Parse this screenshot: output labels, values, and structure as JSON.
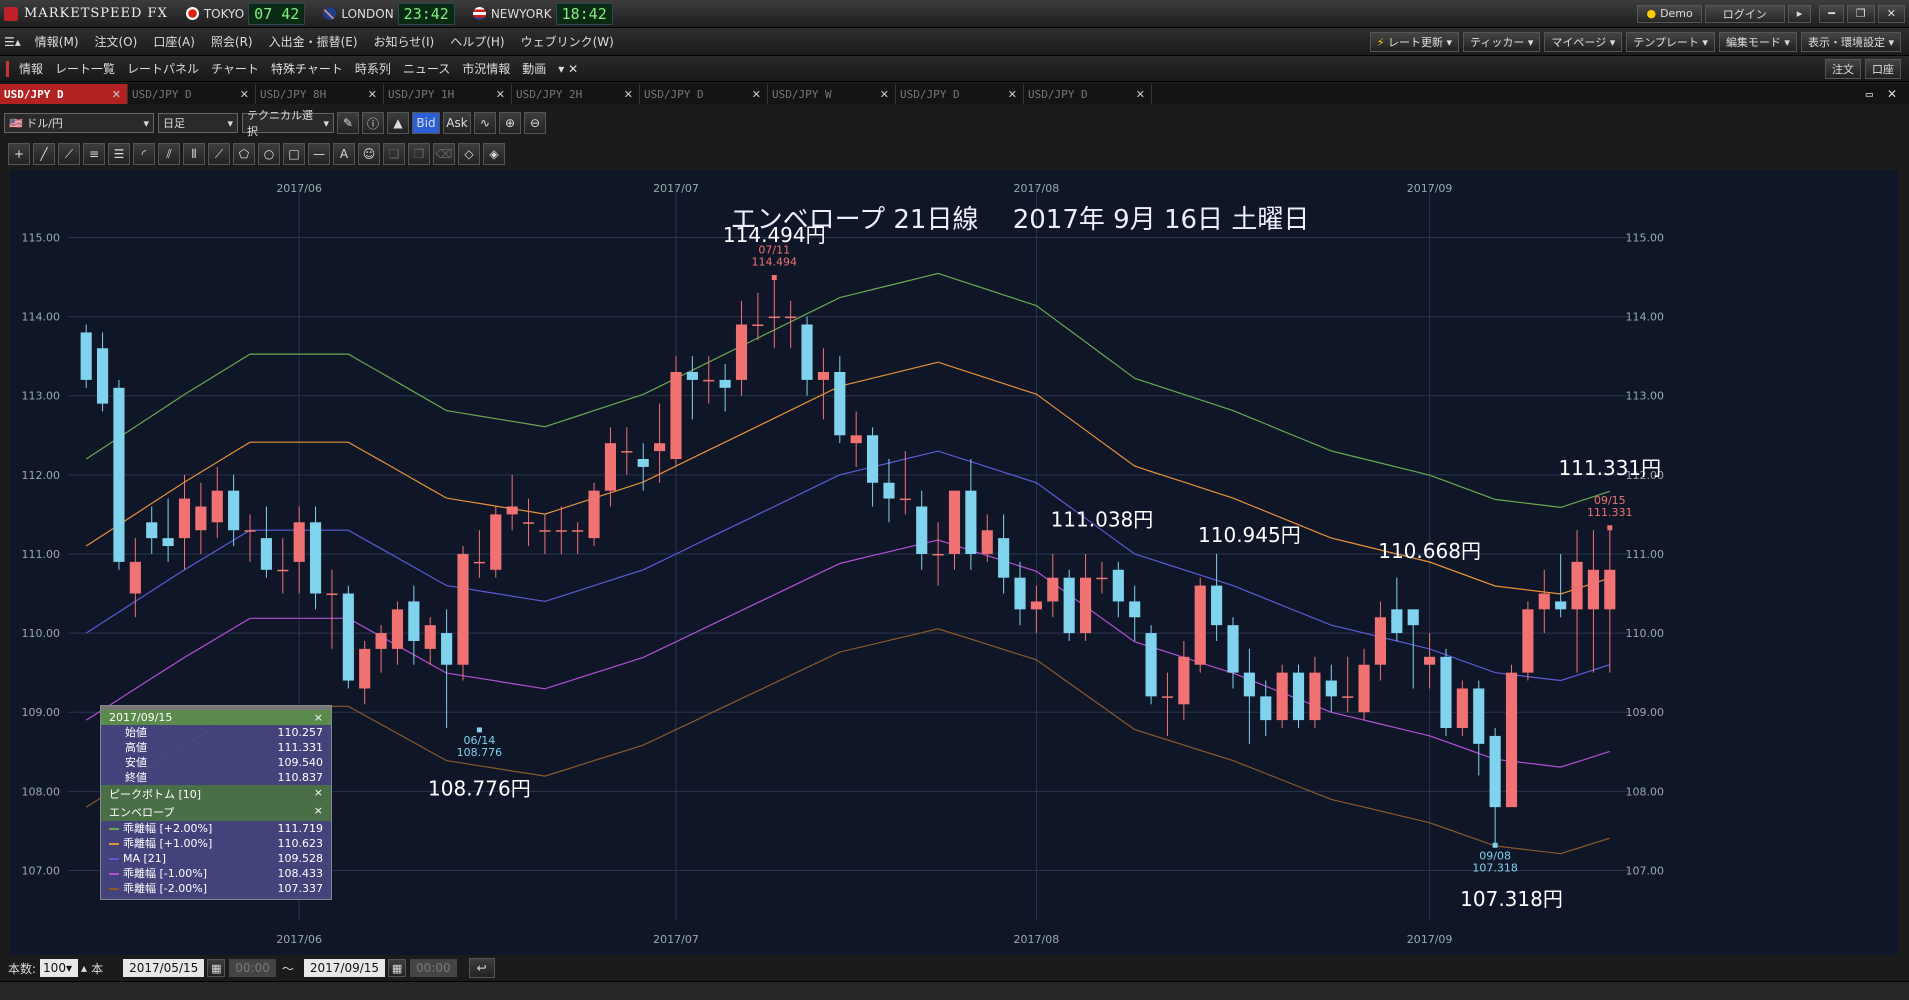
{
  "app": {
    "title": "MARKETSPEED FX"
  },
  "clocks": [
    {
      "city": "TOKYO",
      "time": "07 42"
    },
    {
      "city": "LONDON",
      "time": "23:42"
    },
    {
      "city": "NEWYORK",
      "time": "18:42"
    }
  ],
  "titlebar": {
    "demo": "Demo",
    "login": "ログイン"
  },
  "menu": [
    "情報(M)",
    "注文(O)",
    "口座(A)",
    "照会(R)",
    "入出金・振替(E)",
    "お知らせ(I)",
    "ヘルプ(H)",
    "ウェブリンク(W)"
  ],
  "menu_right": [
    "レート更新",
    "ティッカー",
    "マイページ",
    "テンプレート",
    "編集モード",
    "表示・環境設定"
  ],
  "nav": [
    "情報",
    "レート一覧",
    "レートパネル",
    "チャート",
    "特殊チャート",
    "時系列",
    "ニュース",
    "市況情報",
    "動画"
  ],
  "nav_right": [
    "注文",
    "口座"
  ],
  "tabs": [
    "USD/JPY D",
    "USD/JPY D",
    "USD/JPY 8H",
    "USD/JPY 1H",
    "USD/JPY 2H",
    "USD/JPY D",
    "USD/JPY W",
    "USD/JPY D",
    "USD/JPY D"
  ],
  "toolbar": {
    "pair": "ドル/円",
    "period": "日足",
    "tech": "テクニカル選択",
    "bid": "Bid",
    "ask": "Ask"
  },
  "status": {
    "count_label": "本数:",
    "count": "100",
    "unit": "本",
    "from": "2017/05/15",
    "to": "2017/09/15",
    "tilde": "〜",
    "time1": "00:00",
    "time2": "00:00"
  },
  "info_panel": {
    "date": "2017/09/15",
    "ohlc": [
      {
        "label": "始値",
        "value": "110.257"
      },
      {
        "label": "高値",
        "value": "111.331"
      },
      {
        "label": "安値",
        "value": "109.540"
      },
      {
        "label": "終値",
        "value": "110.837"
      }
    ],
    "peak_label": "ピークボトム [10]",
    "env_label": "エンベロープ",
    "lines": [
      {
        "label": "乖離幅 [+2.00%]",
        "value": "111.719",
        "color": "#6aa84f"
      },
      {
        "label": "乖離幅 [+1.00%]",
        "value": "110.623",
        "color": "#e69138"
      },
      {
        "label": "MA [21]",
        "value": "109.528",
        "color": "#5b5bd6"
      },
      {
        "label": "乖離幅 [-1.00%]",
        "value": "108.433",
        "color": "#b44fd6"
      },
      {
        "label": "乖離幅 [-2.00%]",
        "value": "107.337",
        "color": "#8a5a2a"
      }
    ]
  },
  "chart_data": {
    "type": "candlestick",
    "title": "エンベロープ 21日線　 2017年 9月 16日 土曜日",
    "y_ticks": [
      "115.00",
      "114.00",
      "113.00",
      "112.00",
      "111.00",
      "110.00",
      "109.00",
      "108.00",
      "107.00"
    ],
    "ylim": [
      106.5,
      115.6
    ],
    "x_labels": [
      "2017/06",
      "2017/07",
      "2017/08",
      "2017/09"
    ],
    "x_label_index": [
      13,
      36,
      58,
      82
    ],
    "n": 94,
    "colors": {
      "up": "#f07272",
      "down": "#7fd3ec",
      "bg": "#0f1628",
      "grid": "#2a3550"
    },
    "candles": [
      [
        113.8,
        113.2,
        113.9,
        113.1
      ],
      [
        113.6,
        112.9,
        113.8,
        112.8
      ],
      [
        113.1,
        110.9,
        113.2,
        110.8
      ],
      [
        110.5,
        110.9,
        111.2,
        110.2
      ],
      [
        111.4,
        111.2,
        111.6,
        111.0
      ],
      [
        111.2,
        111.1,
        111.7,
        110.9
      ],
      [
        111.2,
        111.7,
        112.0,
        110.8
      ],
      [
        111.3,
        111.6,
        111.9,
        111.0
      ],
      [
        111.4,
        111.8,
        112.1,
        111.2
      ],
      [
        111.8,
        111.3,
        112.0,
        111.1
      ],
      [
        111.3,
        111.3,
        111.5,
        110.9
      ],
      [
        111.2,
        110.8,
        111.6,
        110.7
      ],
      [
        110.8,
        110.8,
        111.2,
        110.5
      ],
      [
        110.9,
        111.4,
        111.6,
        110.5
      ],
      [
        111.4,
        110.5,
        111.6,
        110.3
      ],
      [
        110.5,
        110.5,
        110.8,
        109.8
      ],
      [
        110.5,
        109.4,
        110.6,
        109.3
      ],
      [
        109.3,
        109.8,
        109.9,
        109.1
      ],
      [
        109.8,
        110.0,
        110.1,
        109.5
      ],
      [
        109.8,
        110.3,
        110.4,
        109.6
      ],
      [
        110.4,
        109.9,
        110.6,
        109.6
      ],
      [
        109.8,
        110.1,
        110.2,
        109.6
      ],
      [
        110.0,
        109.6,
        110.3,
        108.8
      ],
      [
        109.6,
        111.0,
        111.1,
        109.4
      ],
      [
        110.9,
        110.9,
        111.3,
        110.7
      ],
      [
        110.8,
        111.5,
        111.6,
        110.7
      ],
      [
        111.5,
        111.6,
        112.0,
        111.3
      ],
      [
        111.4,
        111.4,
        111.7,
        111.1
      ],
      [
        111.3,
        111.3,
        111.5,
        111.0
      ],
      [
        111.3,
        111.3,
        111.6,
        111.0
      ],
      [
        111.3,
        111.3,
        111.4,
        111.0
      ],
      [
        111.2,
        111.8,
        111.9,
        111.1
      ],
      [
        111.8,
        112.4,
        112.6,
        111.6
      ],
      [
        112.3,
        112.3,
        112.6,
        112.0
      ],
      [
        112.2,
        112.1,
        112.4,
        111.8
      ],
      [
        112.3,
        112.4,
        112.9,
        111.9
      ],
      [
        112.2,
        113.3,
        113.5,
        112.1
      ],
      [
        113.3,
        113.2,
        113.5,
        112.7
      ],
      [
        113.2,
        113.2,
        113.5,
        112.9
      ],
      [
        113.2,
        113.1,
        113.4,
        112.8
      ],
      [
        113.2,
        113.9,
        114.2,
        113.0
      ],
      [
        113.9,
        113.9,
        114.3,
        113.7
      ],
      [
        114.0,
        114.0,
        114.5,
        113.6
      ],
      [
        114.0,
        114.0,
        114.2,
        113.6
      ],
      [
        113.9,
        113.2,
        114.0,
        113.0
      ],
      [
        113.2,
        113.3,
        113.6,
        112.7
      ],
      [
        113.3,
        112.5,
        113.5,
        112.4
      ],
      [
        112.4,
        112.5,
        112.8,
        112.1
      ],
      [
        112.5,
        111.9,
        112.6,
        111.6
      ],
      [
        111.9,
        111.7,
        112.2,
        111.4
      ],
      [
        111.7,
        111.7,
        112.3,
        111.5
      ],
      [
        111.6,
        111.0,
        111.8,
        110.8
      ],
      [
        111.0,
        111.0,
        111.4,
        110.6
      ],
      [
        111.0,
        111.8,
        111.8,
        110.8
      ],
      [
        111.8,
        111.0,
        112.2,
        110.8
      ],
      [
        111.0,
        111.3,
        111.5,
        110.9
      ],
      [
        111.2,
        110.7,
        111.5,
        110.5
      ],
      [
        110.7,
        110.3,
        110.9,
        110.1
      ],
      [
        110.3,
        110.4,
        110.6,
        110.0
      ],
      [
        110.4,
        110.7,
        111.0,
        110.2
      ],
      [
        110.7,
        110.0,
        110.8,
        109.9
      ],
      [
        110.0,
        110.7,
        111.0,
        109.9
      ],
      [
        110.7,
        110.7,
        110.9,
        110.5
      ],
      [
        110.8,
        110.4,
        110.9,
        110.2
      ],
      [
        110.4,
        110.2,
        110.6,
        109.9
      ],
      [
        110.0,
        109.2,
        110.1,
        109.1
      ],
      [
        109.2,
        109.2,
        109.5,
        108.7
      ],
      [
        109.1,
        109.7,
        109.9,
        108.9
      ],
      [
        109.6,
        110.6,
        110.7,
        109.5
      ],
      [
        110.6,
        110.1,
        111.0,
        109.9
      ],
      [
        110.1,
        109.5,
        110.2,
        109.3
      ],
      [
        109.5,
        109.2,
        109.8,
        108.6
      ],
      [
        109.2,
        108.9,
        109.4,
        108.7
      ],
      [
        108.9,
        109.5,
        109.6,
        108.8
      ],
      [
        109.5,
        108.9,
        109.6,
        108.8
      ],
      [
        108.9,
        109.5,
        109.7,
        108.8
      ],
      [
        109.4,
        109.2,
        109.6,
        109.0
      ],
      [
        109.2,
        109.2,
        109.7,
        109.0
      ],
      [
        109.0,
        109.6,
        109.8,
        108.9
      ],
      [
        109.6,
        110.2,
        110.4,
        109.4
      ],
      [
        110.3,
        110.0,
        110.7,
        109.9
      ],
      [
        110.3,
        110.1,
        110.3,
        109.3
      ],
      [
        109.6,
        109.7,
        110.0,
        109.3
      ],
      [
        109.7,
        108.8,
        109.8,
        108.7
      ],
      [
        108.8,
        109.3,
        109.4,
        108.7
      ],
      [
        109.3,
        108.6,
        109.4,
        108.2
      ],
      [
        108.7,
        107.8,
        108.8,
        107.3
      ],
      [
        107.8,
        109.5,
        109.6,
        108.1
      ],
      [
        109.5,
        110.3,
        110.4,
        109.4
      ],
      [
        110.3,
        110.5,
        110.8,
        110.0
      ],
      [
        110.4,
        110.3,
        111.0,
        110.2
      ],
      [
        110.3,
        110.9,
        111.3,
        109.5
      ],
      [
        110.3,
        110.8,
        111.3,
        109.5
      ],
      [
        110.3,
        110.8,
        111.3,
        109.5
      ]
    ],
    "envelope": {
      "ma_label": "MA [21]",
      "pct": [
        2,
        1,
        0,
        -1,
        -2
      ],
      "colors": [
        "#6aa84f",
        "#e69138",
        "#5b5bd6",
        "#b44fd6",
        "#8a5a2a"
      ],
      "ma": [
        [
          0,
          110.0
        ],
        [
          6,
          110.8
        ],
        [
          10,
          111.3
        ],
        [
          16,
          111.3
        ],
        [
          22,
          110.6
        ],
        [
          28,
          110.4
        ],
        [
          34,
          110.8
        ],
        [
          40,
          111.4
        ],
        [
          46,
          112.0
        ],
        [
          52,
          112.3
        ],
        [
          58,
          111.9
        ],
        [
          64,
          111.0
        ],
        [
          70,
          110.6
        ],
        [
          76,
          110.1
        ],
        [
          82,
          109.8
        ],
        [
          86,
          109.5
        ],
        [
          90,
          109.4
        ],
        [
          93,
          109.6
        ]
      ]
    },
    "annotations": [
      {
        "text": "114.494円",
        "i": 42,
        "price": 114.94
      },
      {
        "text": "108.776円",
        "i": 24,
        "price": 107.95
      },
      {
        "text": "111.038円",
        "i": 62,
        "price": 111.35
      },
      {
        "text": "110.945円",
        "i": 71,
        "price": 111.15
      },
      {
        "text": "110.668円",
        "i": 82,
        "price": 110.95
      },
      {
        "text": "111.331円",
        "i": 93,
        "price": 112.0
      },
      {
        "text": "107.318円",
        "i": 87,
        "price": 106.55
      }
    ],
    "peaks": [
      {
        "date": "07/11",
        "value": "114.494",
        "i": 42,
        "price": 114.494,
        "dir": "up"
      },
      {
        "date": "06/14",
        "value": "108.776",
        "i": 24,
        "price": 108.776,
        "dir": "down"
      },
      {
        "date": "09/08",
        "value": "107.318",
        "i": 86,
        "price": 107.318,
        "dir": "down"
      },
      {
        "date": "09/15",
        "value": "111.331",
        "i": 93,
        "price": 111.331,
        "dir": "up"
      }
    ]
  }
}
